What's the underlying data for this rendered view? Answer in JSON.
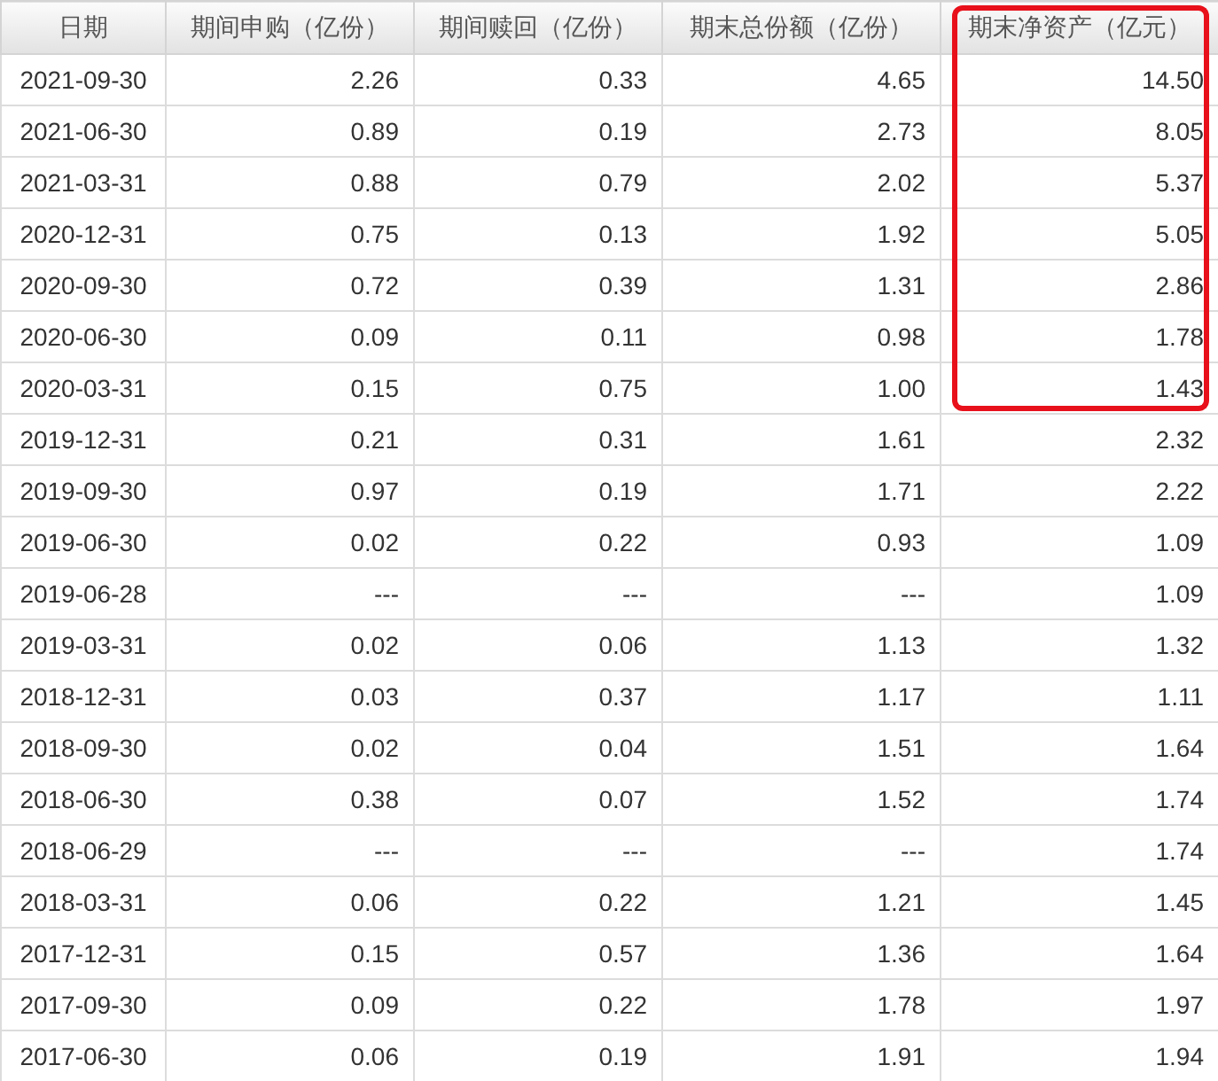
{
  "table": {
    "columns": [
      {
        "label": "日期",
        "highlighted": false
      },
      {
        "label": "期间申购（亿份）",
        "highlighted": false
      },
      {
        "label": "期间赎回（亿份）",
        "highlighted": false
      },
      {
        "label": "期末总份额（亿份）",
        "highlighted": false
      },
      {
        "label": "期末净资产（亿元）",
        "highlighted": true
      }
    ],
    "rows": [
      {
        "cells": [
          "2021-09-30",
          "2.26",
          "0.33",
          "4.65",
          "14.50"
        ],
        "highlighted": true
      },
      {
        "cells": [
          "2021-06-30",
          "0.89",
          "0.19",
          "2.73",
          "8.05"
        ],
        "highlighted": true
      },
      {
        "cells": [
          "2021-03-31",
          "0.88",
          "0.79",
          "2.02",
          "5.37"
        ],
        "highlighted": true
      },
      {
        "cells": [
          "2020-12-31",
          "0.75",
          "0.13",
          "1.92",
          "5.05"
        ],
        "highlighted": true
      },
      {
        "cells": [
          "2020-09-30",
          "0.72",
          "0.39",
          "1.31",
          "2.86"
        ],
        "highlighted": true
      },
      {
        "cells": [
          "2020-06-30",
          "0.09",
          "0.11",
          "0.98",
          "1.78"
        ],
        "highlighted": true
      },
      {
        "cells": [
          "2020-03-31",
          "0.15",
          "0.75",
          "1.00",
          "1.43"
        ],
        "highlighted": true
      },
      {
        "cells": [
          "2019-12-31",
          "0.21",
          "0.31",
          "1.61",
          "2.32"
        ],
        "highlighted": false
      },
      {
        "cells": [
          "2019-09-30",
          "0.97",
          "0.19",
          "1.71",
          "2.22"
        ],
        "highlighted": false
      },
      {
        "cells": [
          "2019-06-30",
          "0.02",
          "0.22",
          "0.93",
          "1.09"
        ],
        "highlighted": false
      },
      {
        "cells": [
          "2019-06-28",
          "---",
          "---",
          "---",
          "1.09"
        ],
        "highlighted": false
      },
      {
        "cells": [
          "2019-03-31",
          "0.02",
          "0.06",
          "1.13",
          "1.32"
        ],
        "highlighted": false
      },
      {
        "cells": [
          "2018-12-31",
          "0.03",
          "0.37",
          "1.17",
          "1.11"
        ],
        "highlighted": false
      },
      {
        "cells": [
          "2018-09-30",
          "0.02",
          "0.04",
          "1.51",
          "1.64"
        ],
        "highlighted": false
      },
      {
        "cells": [
          "2018-06-30",
          "0.38",
          "0.07",
          "1.52",
          "1.74"
        ],
        "highlighted": false
      },
      {
        "cells": [
          "2018-06-29",
          "---",
          "---",
          "---",
          "1.74"
        ],
        "highlighted": false
      },
      {
        "cells": [
          "2018-03-31",
          "0.06",
          "0.22",
          "1.21",
          "1.45"
        ],
        "highlighted": false
      },
      {
        "cells": [
          "2017-12-31",
          "0.15",
          "0.57",
          "1.36",
          "1.64"
        ],
        "highlighted": false
      },
      {
        "cells": [
          "2017-09-30",
          "0.09",
          "0.22",
          "1.78",
          "1.97"
        ],
        "highlighted": false
      },
      {
        "cells": [
          "2017-06-30",
          "0.06",
          "0.19",
          "1.91",
          "1.94"
        ],
        "highlighted": false
      }
    ]
  }
}
